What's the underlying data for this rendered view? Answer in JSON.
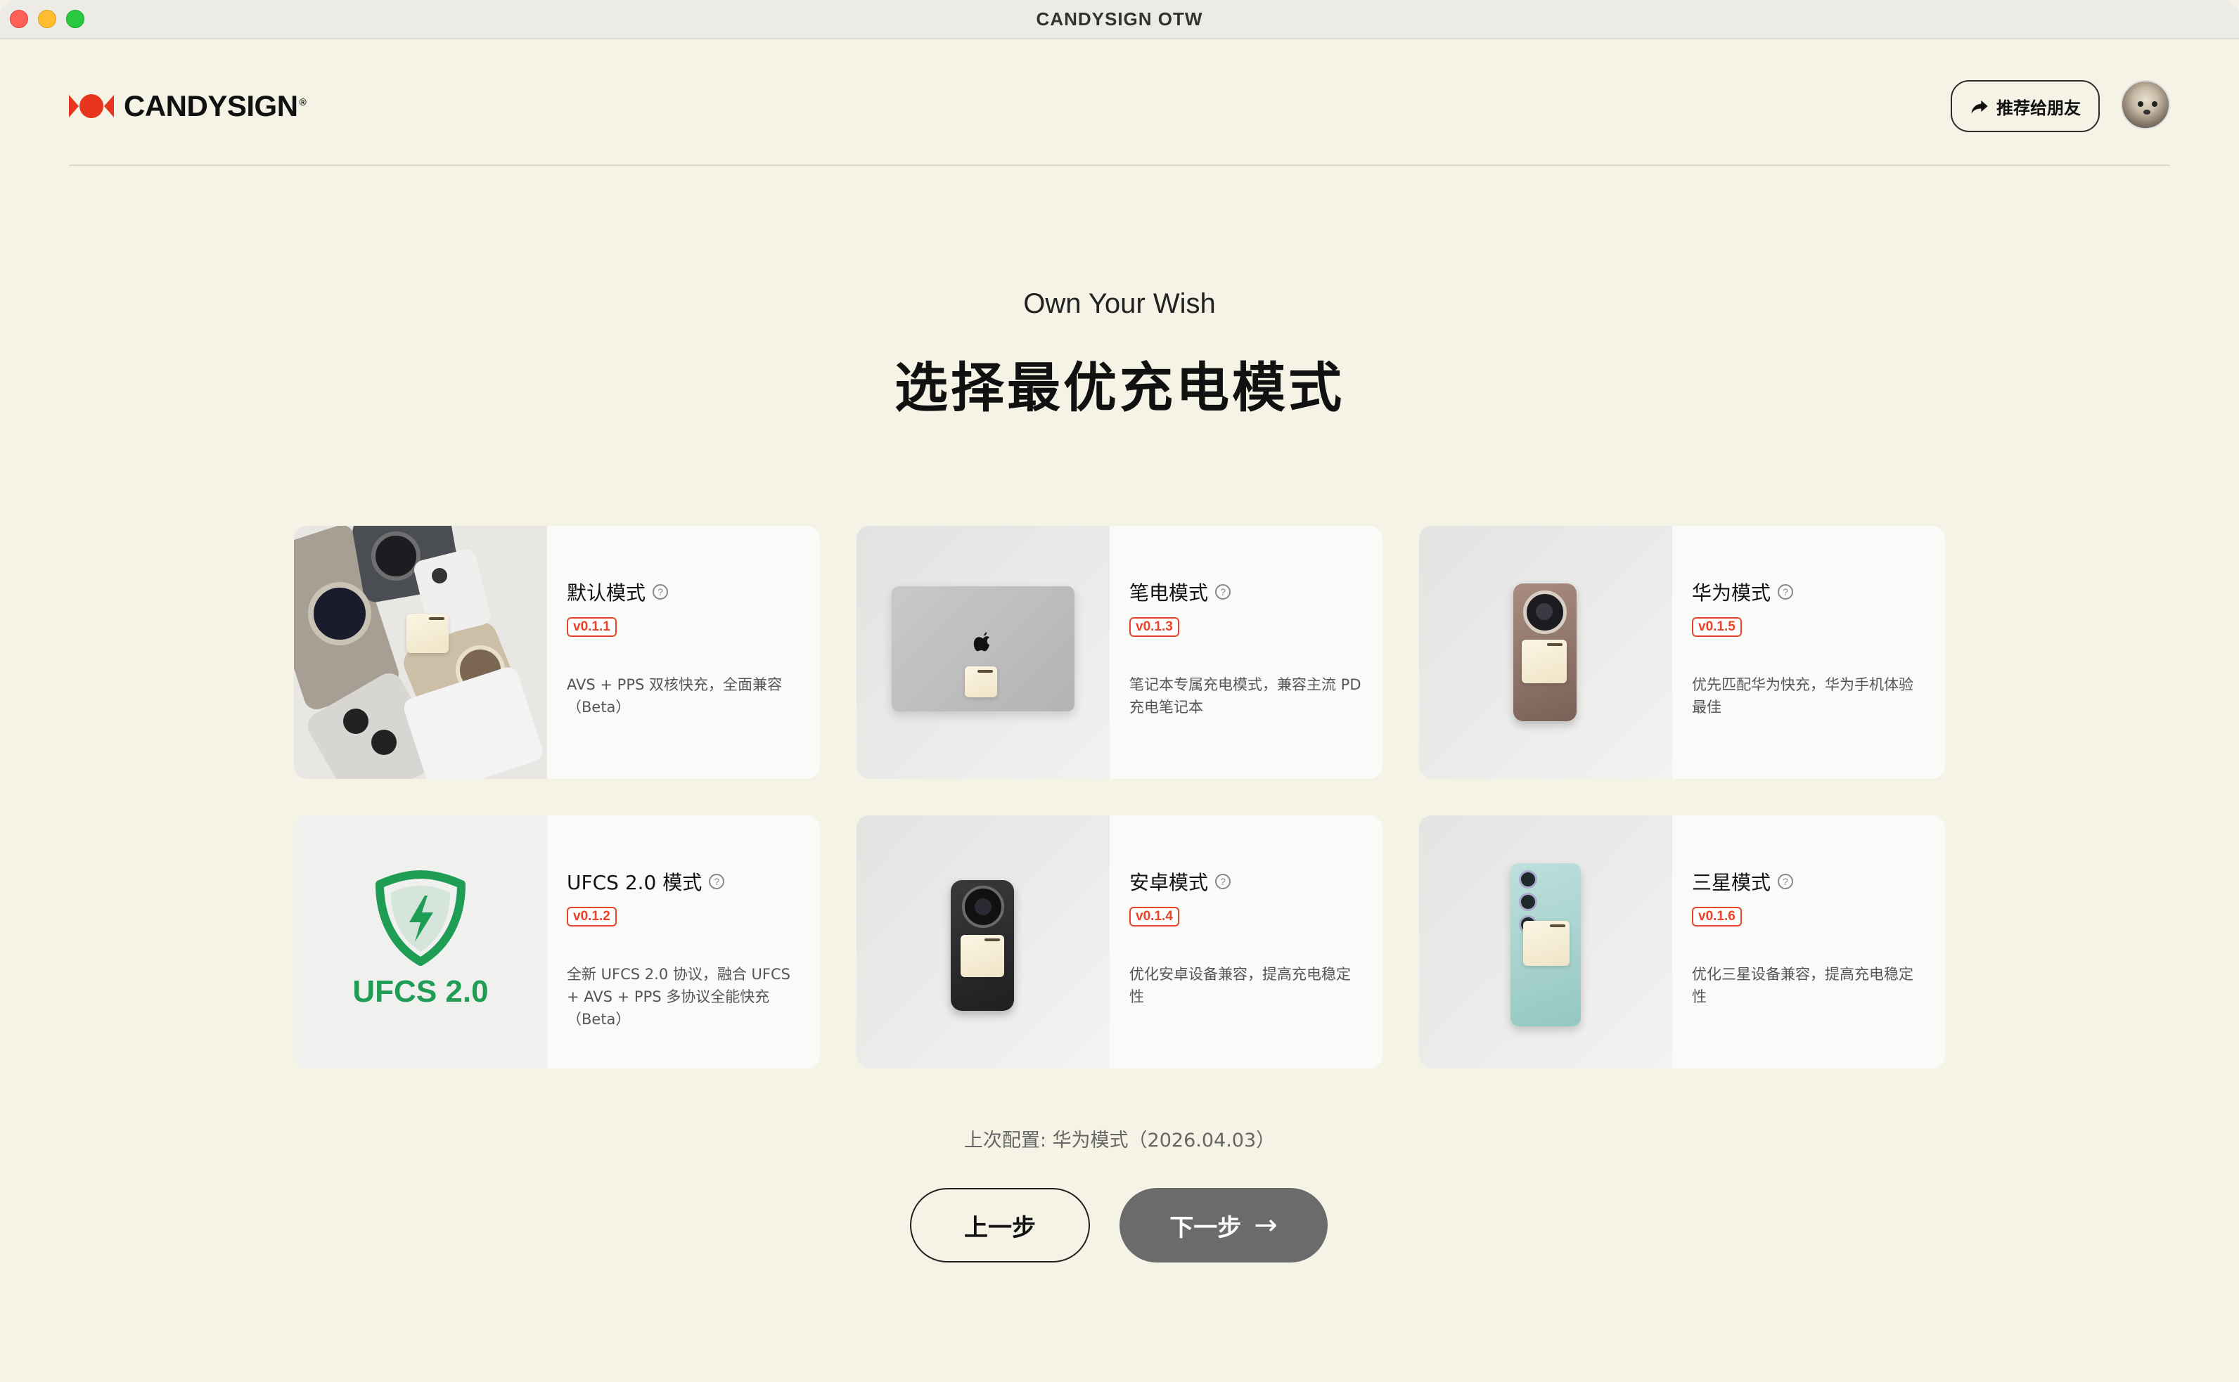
{
  "window": {
    "title": "CANDYSIGN OTW"
  },
  "header": {
    "logo_text": "CANDYSIGN",
    "logo_reg": "®",
    "share_label": "推荐给朋友"
  },
  "hero": {
    "subtitle": "Own Your Wish",
    "title": "选择最优充电模式"
  },
  "modes": [
    {
      "name": "默认模式",
      "version": "v0.1.1",
      "desc": "AVS + PPS 双核快充，全面兼容（Beta）",
      "image": "phones-collection"
    },
    {
      "name": "笔电模式",
      "version": "v0.1.3",
      "desc": "笔记本专属充电模式，兼容主流 PD 充电笔记本",
      "image": "laptop"
    },
    {
      "name": "华为模式",
      "version": "v0.1.5",
      "desc": "优先匹配华为快充，华为手机体验最佳",
      "image": "huawei-phone"
    },
    {
      "name": "UFCS 2.0 模式",
      "version": "v0.1.2",
      "desc": "全新 UFCS 2.0 协议，融合 UFCS + AVS + PPS 多协议全能快充（Beta）",
      "image": "ufcs-shield",
      "logo_text": "UFCS 2.0"
    },
    {
      "name": "安卓模式",
      "version": "v0.1.4",
      "desc": "优化安卓设备兼容，提高充电稳定性",
      "image": "android-phone"
    },
    {
      "name": "三星模式",
      "version": "v0.1.6",
      "desc": "优化三星设备兼容，提高充电稳定性",
      "image": "samsung-phone"
    }
  ],
  "footer": {
    "last_config": "上次配置: 华为模式（2026.04.03）",
    "prev_label": "上一步",
    "next_label": "下一步",
    "next_arrow": "→"
  },
  "colors": {
    "background": "#f5f2e6",
    "accent": "#e8442a",
    "ufcs_green": "#1f9d55",
    "next_button": "#6b6b6b"
  }
}
